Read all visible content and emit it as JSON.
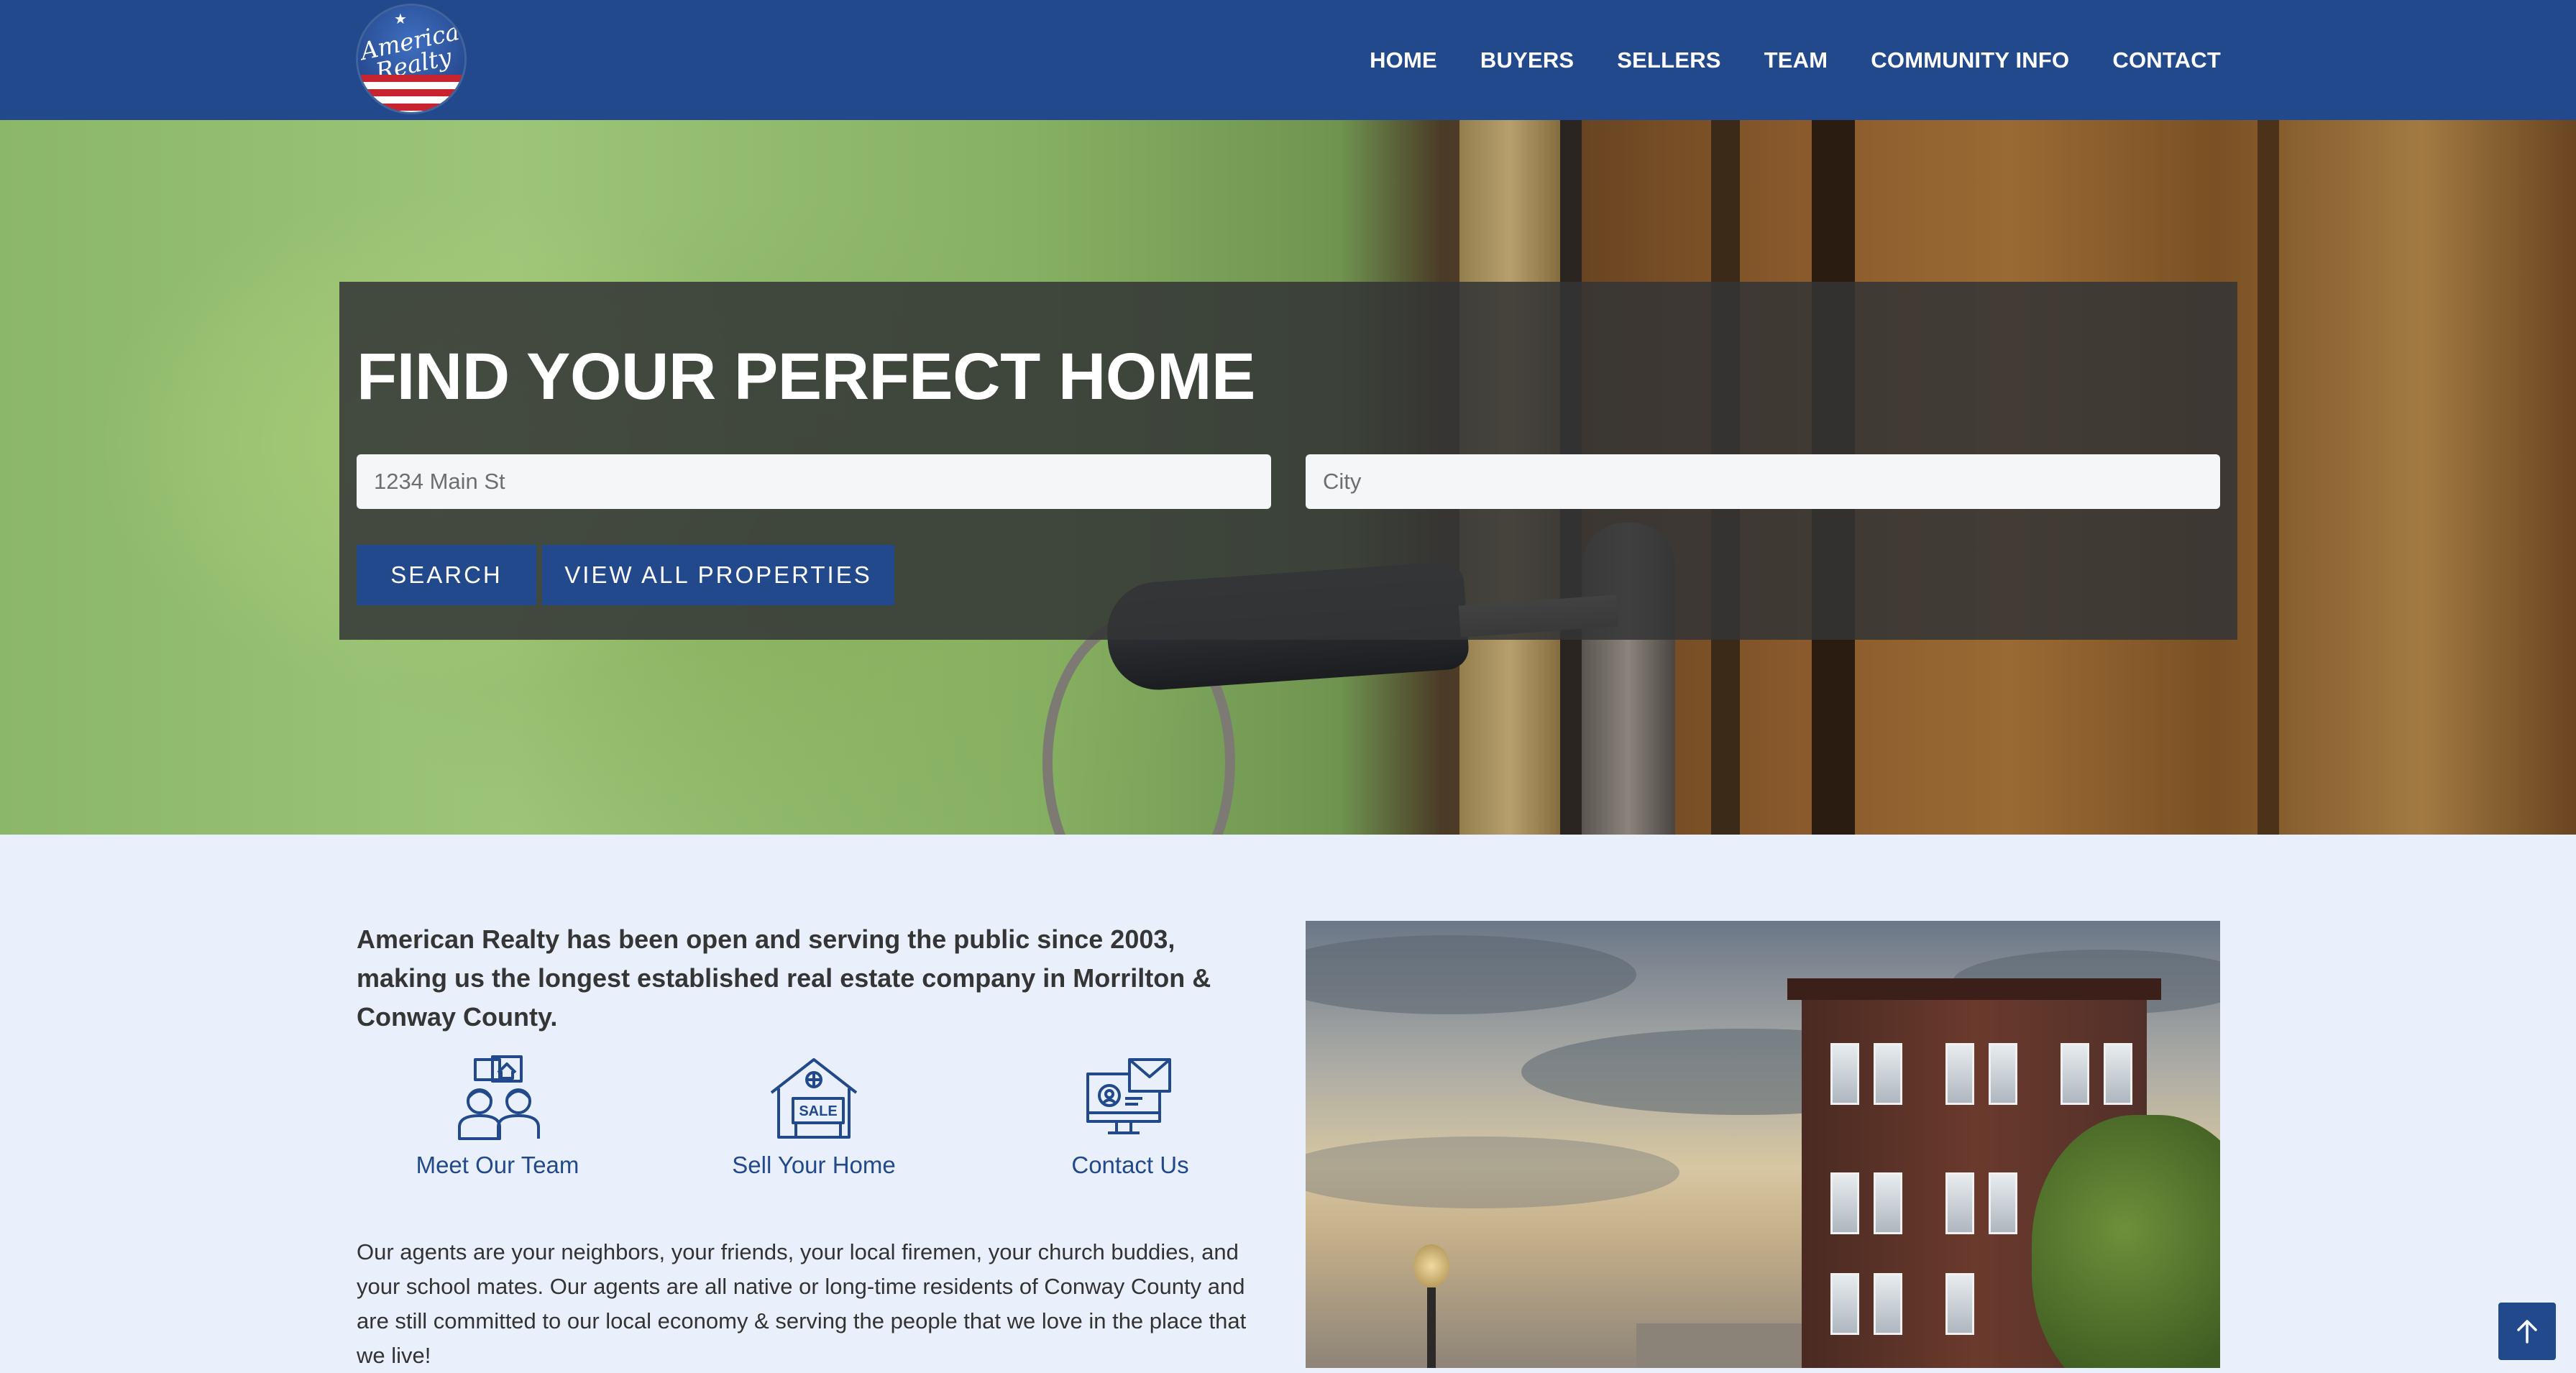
{
  "header": {
    "logo_text": "American Realty",
    "nav": [
      "HOME",
      "BUYERS",
      "SELLERS",
      "TEAM",
      "COMMUNITY INFO",
      "CONTACT"
    ]
  },
  "hero": {
    "title": "FIND YOUR PERFECT HOME",
    "address_placeholder": "1234 Main St",
    "city_placeholder": "City",
    "search_button": "SEARCH",
    "view_all_button": "VIEW ALL PROPERTIES"
  },
  "content": {
    "intro": "American Realty has been open and serving the public since 2003, making us the longest established real estate company in Morrilton & Conway County.",
    "features": [
      {
        "label": "Meet Our Team",
        "icon": "team-icon"
      },
      {
        "label": "Sell Your Home",
        "icon": "house-sale-icon",
        "sign_text": "SALE"
      },
      {
        "label": "Contact Us",
        "icon": "contact-computer-icon"
      }
    ],
    "about": "Our agents are your neighbors, your friends, your local firemen, your church buddies, and your school mates. Our agents are all native or long-time residents of Conway County and are still committed to our local economy & serving the people that we love in the place that we live!"
  },
  "scroll_top": {
    "icon": "arrow-up-icon"
  },
  "colors": {
    "brand_blue": "#21498b",
    "page_background": "#e9f0fb",
    "panel_overlay": "#333435"
  }
}
